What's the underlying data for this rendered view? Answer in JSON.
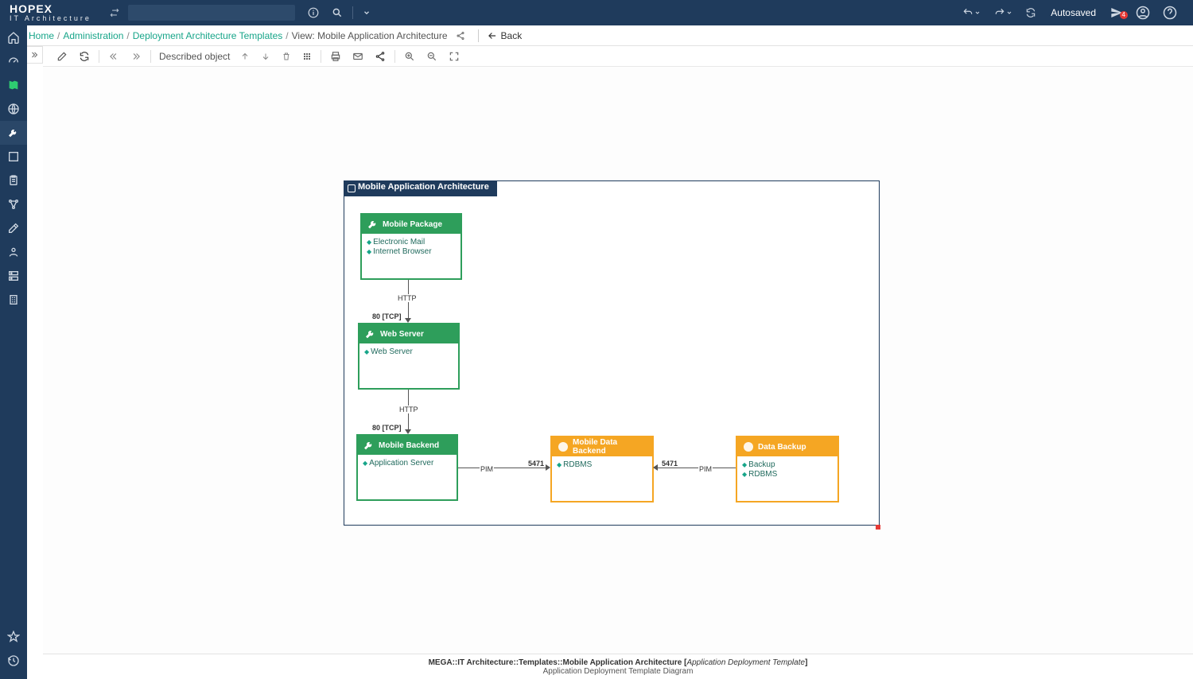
{
  "brand": {
    "main": "HOPEX",
    "sub": "IT Architecture"
  },
  "topbar": {
    "autosaved": "Autosaved",
    "notif_count": "4"
  },
  "breadcrumb": {
    "home": "Home",
    "admin": "Administration",
    "templates": "Deployment Architecture Templates",
    "view": "View: Mobile Application Architecture",
    "back": "Back"
  },
  "toolbar": {
    "described": "Described object"
  },
  "diagram": {
    "title": "Mobile Application Architecture",
    "nodes": {
      "mobile_package": {
        "title": "Mobile Package",
        "items": [
          "Electronic Mail",
          "Internet Browser"
        ]
      },
      "web_server": {
        "title": "Web Server",
        "items": [
          "Web Server"
        ]
      },
      "mobile_backend": {
        "title": "Mobile Backend",
        "items": [
          "Application Server"
        ]
      },
      "mobile_data_backend": {
        "title": "Mobile Data Backend",
        "items": [
          "RDBMS"
        ]
      },
      "data_backup": {
        "title": "Data Backup",
        "items": [
          "Backup",
          "RDBMS"
        ]
      }
    },
    "connections": {
      "c1": {
        "label": "HTTP",
        "port": "80 [TCP]"
      },
      "c2": {
        "label": "HTTP",
        "port": "80 [TCP]"
      },
      "c3": {
        "label": "PIM",
        "port": "5471"
      },
      "c4": {
        "label": "PIM",
        "port": "5471"
      }
    }
  },
  "footer": {
    "path": "MEGA::IT Architecture::Templates::Mobile Application Architecture ",
    "type": "Application Deployment Template",
    "sub": "Application Deployment Template Diagram"
  }
}
